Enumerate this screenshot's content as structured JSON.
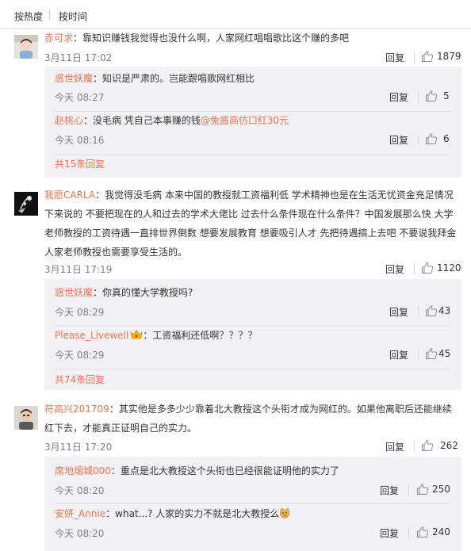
{
  "sort": {
    "hot": "按热度",
    "time": "按时间"
  },
  "comments": [
    {
      "user": "赤可求",
      "text": "靠知识赚钱我觉得也没什么啊，人家网红唱唱歌比这个赚的多吧",
      "time": "3月11日 17:02",
      "reply": "回复",
      "likes": "1879",
      "replies": [
        {
          "user": "惑世妖魔",
          "text": "知识是严肃的。岂能跟唱歌网红相比",
          "time": "今天 08:27",
          "reply": "回复",
          "likes": "5"
        },
        {
          "user": "赵桃心",
          "text": "没毛病 凭自己本事赚的钱",
          "tag": "@兔酱高仿口红30元",
          "time": "今天 08:16",
          "reply": "回复",
          "likes": "6"
        }
      ],
      "more": "共15条回复"
    },
    {
      "user": "我愿CARLA",
      "text_lines": [
        "我觉得没毛病 本来中国的教授就工资福利低 学术精神也是在生活无忧资金充足情况",
        "下来说的 不要把现在的人和过去的学术大佬比 过去什么条件现在什么条件？中国发展那么快 大学",
        "老师教授的工资待遇一直排世界倒数 想要发展教育 想要吸引人才 先把待遇搞上去吧 不要说我拜金",
        "人家老师教授也需要享受生活的。"
      ],
      "time": "3月11日 17:19",
      "reply": "回复",
      "likes": "1120",
      "replies": [
        {
          "user": "惑世妖魔",
          "text": "你真的懂大学教授吗?",
          "time": "今天 08:29",
          "reply": "回复",
          "likes": "43"
        },
        {
          "user": "Please_Livewell",
          "text": "工资福利还低啊？？？？",
          "time": "今天 08:29",
          "reply": "回复",
          "likes": "45"
        }
      ],
      "more": "共74条回复"
    },
    {
      "user": "符高兴201709",
      "text_lines": [
        "其实他是多多少少靠着北大教授这个头衔才成为网红的。如果他离职后还能继续",
        "红下去，才能真正证明自己的实力。"
      ],
      "time": "3月11日 17:20",
      "reply": "回复",
      "likes": "262",
      "replies": [
        {
          "user": "席地烟城000",
          "text": "重点是北大教授这个头衔也已经很能证明他的实力了",
          "time": "今天 08:20",
          "reply": "回复",
          "likes": "250"
        },
        {
          "user": "安妍_Annie",
          "text": "what...? 人家的实力不就是北大教授么",
          "time": "今天 08:20",
          "reply": "回复",
          "likes": "240"
        }
      ]
    }
  ],
  "icons": {
    "like": "thumbs-up-icon",
    "crown": "crown-badge-icon",
    "cat": "cat-face-emoji-icon"
  },
  "colors": {
    "username": "#eb7350",
    "reply_bg": "#f2f2f5",
    "meta": "#808080"
  }
}
